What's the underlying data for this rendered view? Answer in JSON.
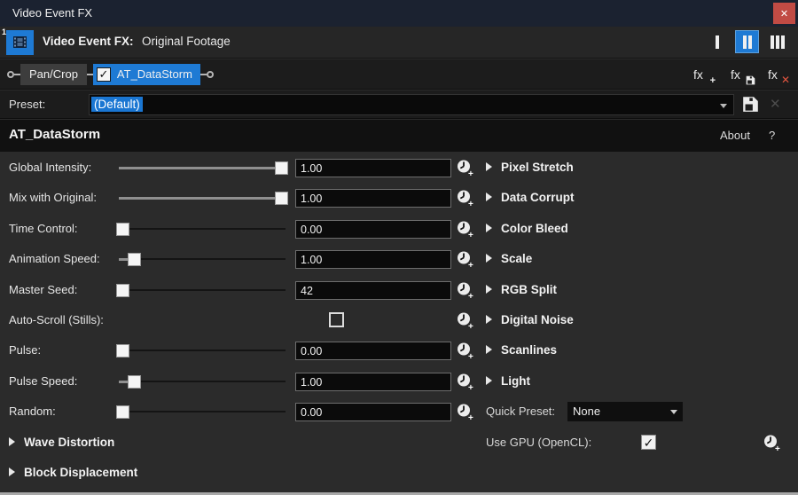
{
  "window": {
    "title": "Video Event FX"
  },
  "titlebar": {
    "close_glyph": "✕"
  },
  "event_header": {
    "badge": "1",
    "title_label": "Video Event FX:",
    "event_name": "Original Footage",
    "layout_buttons": [
      {
        "name": "layout-one-pane",
        "bars": 1,
        "selected": false
      },
      {
        "name": "layout-two-pane",
        "bars": 2,
        "selected": true
      },
      {
        "name": "layout-three-pane",
        "bars": 3,
        "selected": false
      }
    ]
  },
  "chain": {
    "items": [
      {
        "label": "Pan/Crop",
        "has_checkbox": false,
        "selected": false
      },
      {
        "label": "AT_DataStorm",
        "has_checkbox": true,
        "checked": true,
        "check_glyph": "✓",
        "selected": true
      }
    ]
  },
  "fx_toolbar": {
    "glyph": "fx",
    "add_sub": "+",
    "remove_sub": "✕"
  },
  "preset_bar": {
    "label": "Preset:",
    "value": "(Default)",
    "delete_glyph": "✕"
  },
  "plugin_header": {
    "title": "AT_DataStorm",
    "about_label": "About",
    "help_label": "?"
  },
  "params": [
    {
      "label": "Global Intensity:",
      "type": "slider",
      "fill": 1.0,
      "value": "1.00"
    },
    {
      "label": "Mix with Original:",
      "type": "slider",
      "fill": 1.0,
      "value": "1.00"
    },
    {
      "label": "Time Control:",
      "type": "slider",
      "fill": 0.0,
      "value": "0.00"
    },
    {
      "label": "Animation Speed:",
      "type": "slider",
      "fill": 0.07,
      "value": "1.00"
    },
    {
      "label": "Master Seed:",
      "type": "slider",
      "fill": 0.0,
      "value": "42"
    },
    {
      "label": "Auto-Scroll (Stills):",
      "type": "checkbox",
      "checked": false
    },
    {
      "label": "Pulse:",
      "type": "slider",
      "fill": 0.0,
      "value": "0.00"
    },
    {
      "label": "Pulse Speed:",
      "type": "slider",
      "fill": 0.07,
      "value": "1.00"
    },
    {
      "label": "Random:",
      "type": "slider",
      "fill": 0.0,
      "value": "0.00"
    }
  ],
  "right_sections": [
    "Pixel Stretch",
    "Data Corrupt",
    "Color Bleed",
    "Scale",
    "RGB Split",
    "Digital Noise",
    "Scanlines",
    "Light"
  ],
  "quick_preset": {
    "label": "Quick Preset:",
    "value": "None"
  },
  "gpu_row": {
    "label": "Use GPU (OpenCL):",
    "checked": true,
    "check_glyph": "✓"
  },
  "bottom_sections": [
    "Wave Distortion",
    "Block Displacement"
  ],
  "colors": {
    "accent": "#1e7ad4",
    "close_red": "#c14b44",
    "selection": "#1a76d2"
  }
}
